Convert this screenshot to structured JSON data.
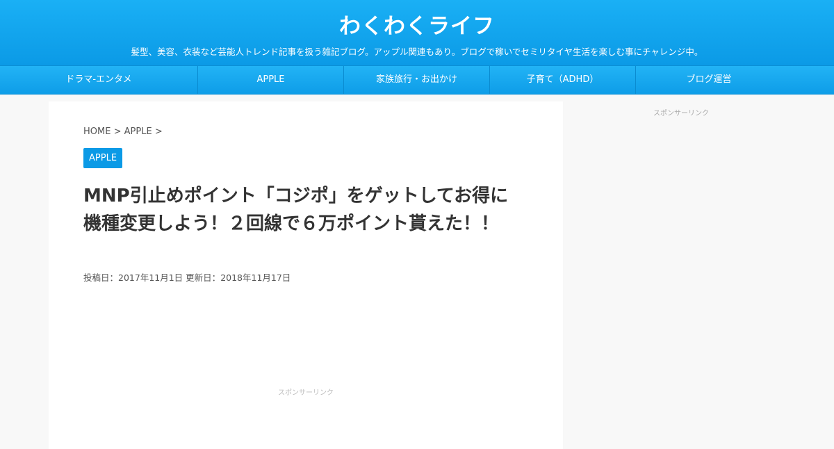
{
  "header": {
    "title": "わくわくライフ",
    "description": "髪型、美容、衣装など芸能人トレンド記事を扱う雑記ブログ。アップル関連もあり。ブログで稼いでセミリタイヤ生活を楽しむ事にチャレンジ中。"
  },
  "nav": {
    "items": [
      {
        "label": "ドラマ-エンタメ"
      },
      {
        "label": "APPLE"
      },
      {
        "label": "家族旅行・お出かけ"
      },
      {
        "label": "子育て（ADHD）"
      },
      {
        "label": "ブログ運営"
      }
    ]
  },
  "breadcrumb": {
    "home": "HOME",
    "sep1": ">",
    "category": "APPLE",
    "sep2": ">"
  },
  "article": {
    "category_badge": "APPLE",
    "title": "MNP引止めポイント「コジポ」をゲットしてお得に機種変更しよう！２回線で６万ポイント貰えた！！",
    "posted_label": "投稿日：",
    "posted_date": "2017年11月1日",
    "updated_label": "更新日：",
    "updated_date": "2018年11月17日"
  },
  "ads": {
    "main_label": "スポンサーリンク",
    "side_label": "スポンサーリンク"
  }
}
